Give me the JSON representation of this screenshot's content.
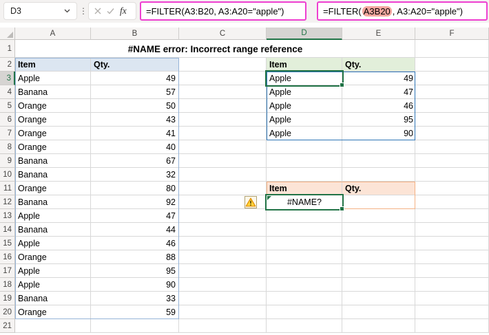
{
  "title": "#NAME error: Incorrect range reference",
  "formula_bar": {
    "name_box": "D3",
    "fx_label": "fx",
    "formula1": "=FILTER(A3:B20, A3:A20=\"apple\")",
    "formula2_prefix": "=FILTER(",
    "formula2_highlight": "A3B20",
    "formula2_suffix": ", A3:A20=\"apple\")"
  },
  "grid": {
    "column_letters": [
      "A",
      "B",
      "C",
      "D",
      "E",
      "F"
    ],
    "row_numbers": [
      1,
      2,
      3,
      4,
      5,
      6,
      7,
      8,
      9,
      10,
      11,
      12,
      13,
      14,
      15,
      16,
      17,
      18,
      19,
      20,
      21
    ],
    "selected_column": "D",
    "selected_row": 3
  },
  "source_table": {
    "headers": [
      "Item",
      "Qty."
    ],
    "rows": [
      [
        "Apple",
        49
      ],
      [
        "Banana",
        57
      ],
      [
        "Orange",
        50
      ],
      [
        "Orange",
        43
      ],
      [
        "Orange",
        41
      ],
      [
        "Orange",
        40
      ],
      [
        "Banana",
        67
      ],
      [
        "Banana",
        32
      ],
      [
        "Orange",
        80
      ],
      [
        "Banana",
        92
      ],
      [
        "Apple",
        47
      ],
      [
        "Banana",
        44
      ],
      [
        "Apple",
        46
      ],
      [
        "Orange",
        88
      ],
      [
        "Apple",
        95
      ],
      [
        "Apple",
        90
      ],
      [
        "Banana",
        33
      ],
      [
        "Orange",
        59
      ]
    ]
  },
  "filtered_table": {
    "headers": [
      "Item",
      "Qty."
    ],
    "rows": [
      [
        "Apple",
        49
      ],
      [
        "Apple",
        47
      ],
      [
        "Apple",
        46
      ],
      [
        "Apple",
        95
      ],
      [
        "Apple",
        90
      ]
    ]
  },
  "error_table": {
    "headers": [
      "Item",
      "Qty."
    ],
    "error_value": "#NAME?"
  },
  "colors": {
    "accent_magenta": "#ee3fd0",
    "highlight_salmon": "#f5a8a0",
    "selection_green": "#217346",
    "spill_blue": "#2e75b6",
    "table_outline_blue": "#95b3d7",
    "table_outline_orange": "#f4b183",
    "header_fill_blue": "#dce6f1",
    "header_fill_green": "#e2efda",
    "header_fill_peach": "#fce4d6",
    "gridline": "#d8d8d8",
    "header_bg": "#f5f3f2",
    "header_selected_bg": "#d6d4d2",
    "warning_yellow": "#ffd43c",
    "warning_orange": "#e08d00"
  }
}
